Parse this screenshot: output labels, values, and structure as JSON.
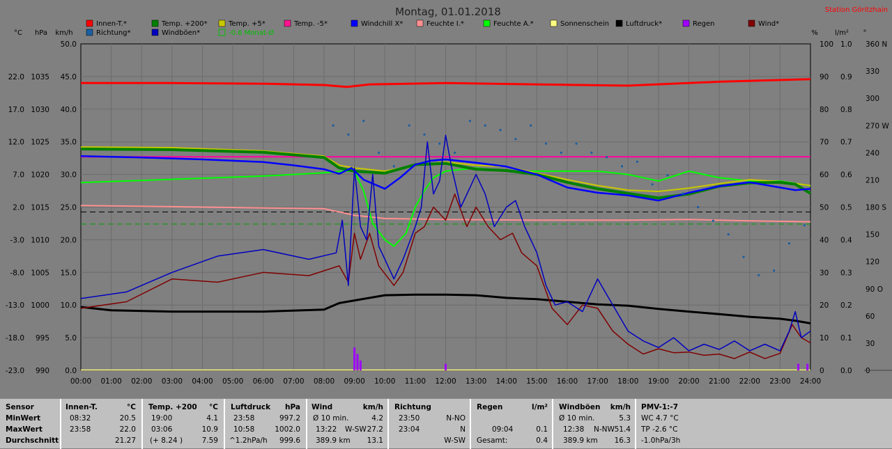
{
  "title": "Montag, 01.01.2018",
  "station": "Station Göritzhain",
  "colors": {
    "innen": "#ff0000",
    "temp200": "#008000",
    "temp5": "#c8c800",
    "tempm5": "#ff00a0",
    "windchill": "#0000ff",
    "feuchte_i": "#ff9090",
    "feuchte_a": "#00ff00",
    "sonne": "#ffff80",
    "luftdruck": "#000000",
    "regen": "#a000ff",
    "wind": "#800000",
    "richtung": "#1a5fa0",
    "windboeen": "#0000c0",
    "monat": "#00a000"
  },
  "legend": [
    {
      "label": "Innen-T.*",
      "color": "#ff0000",
      "style": "box"
    },
    {
      "label": "Temp. +200*",
      "color": "#008000",
      "style": "box"
    },
    {
      "label": "Temp. +5*",
      "color": "#c8c800",
      "style": "box"
    },
    {
      "label": "Temp. -5*",
      "color": "#ff1493",
      "style": "box"
    },
    {
      "label": "Windchill X*",
      "color": "#0000ff",
      "style": "box"
    },
    {
      "label": "Feuchte I.*",
      "color": "#ff9090",
      "style": "box"
    },
    {
      "label": "Feuchte A.*",
      "color": "#00ff00",
      "style": "box"
    },
    {
      "label": "Sonnenschein",
      "color": "#ffff80",
      "style": "box"
    },
    {
      "label": "Luftdruck*",
      "color": "#000000",
      "style": "box"
    },
    {
      "label": "Regen",
      "color": "#a000ff",
      "style": "box"
    },
    {
      "label": "Wind*",
      "color": "#800000",
      "style": "box"
    },
    {
      "label": "Richtung*",
      "color": "#1a5fa0",
      "style": "box"
    },
    {
      "label": "Windböen*",
      "color": "#0000c0",
      "style": "box"
    },
    {
      "label": "-0.6 Monat-Ø",
      "color": "#00c000",
      "style": "outline"
    }
  ],
  "axis_headers": {
    "celsius": "°C",
    "hpa": "hPa",
    "kmh": "km/h",
    "percent": "%",
    "lm2": "l/m²",
    "deg": "°"
  },
  "chart_data": {
    "type": "line",
    "x_ticks": [
      "00:00",
      "01:00",
      "02:00",
      "03:00",
      "04:00",
      "05:00",
      "06:00",
      "07:00",
      "08:00",
      "09:00",
      "10:00",
      "11:00",
      "12:00",
      "13:00",
      "14:00",
      "15:00",
      "16:00",
      "17:00",
      "18:00",
      "19:00",
      "20:00",
      "21:00",
      "22:00",
      "23:00",
      "24:00"
    ],
    "y_axes": {
      "celsius": {
        "ticks": [
          "22.0",
          "17.0",
          "12.0",
          "7.0",
          "2.0",
          "-3.0",
          "-8.0",
          "-13.0",
          "-18.0",
          "-23.0"
        ],
        "range": [
          -23,
          27
        ]
      },
      "hpa": {
        "ticks": [
          "1035",
          "1030",
          "1025",
          "1020",
          "1015",
          "1010",
          "1005",
          "1000",
          "995",
          "990"
        ],
        "range": [
          990,
          1040
        ]
      },
      "kmh": {
        "ticks": [
          "50.0",
          "45.0",
          "40.0",
          "35.0",
          "30.0",
          "25.0",
          "20.0",
          "15.0",
          "10.0",
          "5.0",
          "0.0"
        ],
        "range": [
          0,
          50
        ]
      },
      "percent": {
        "ticks": [
          "100",
          "90",
          "80",
          "70",
          "60",
          "50",
          "40",
          "30",
          "20",
          "10",
          "0"
        ],
        "range": [
          0,
          100
        ]
      },
      "lm2": {
        "ticks": [
          "1.0",
          "0.9",
          "0.8",
          "0.7",
          "0.6",
          "0.5",
          "0.4",
          "0.3",
          "0.2",
          "0.1",
          "0.0"
        ],
        "range": [
          0,
          1
        ]
      },
      "deg": {
        "ticks": [
          "360 N",
          "330",
          "300",
          "270 W",
          "240",
          "210",
          "180 S",
          "150",
          "120",
          "90 O",
          "60",
          "30",
          "0"
        ],
        "range": [
          0,
          360
        ]
      }
    },
    "series": [
      {
        "name": "Innen-T.*",
        "axis": "celsius",
        "x": [
          0,
          3,
          6,
          8,
          8.75,
          9.5,
          12,
          15,
          18,
          21,
          24
        ],
        "y": [
          21.0,
          21.0,
          20.9,
          20.7,
          20.4,
          20.8,
          21.0,
          20.8,
          20.6,
          21.2,
          21.6
        ]
      },
      {
        "name": "Temp. +200*",
        "axis": "celsius",
        "x": [
          0,
          3,
          6,
          8,
          8.5,
          9,
          10,
          11,
          12,
          13,
          14,
          15,
          16,
          17,
          18,
          19,
          20,
          21,
          22,
          23,
          23.5,
          24
        ],
        "y": [
          10.9,
          10.8,
          10.4,
          9.6,
          8.0,
          7.5,
          7.2,
          8.5,
          8.7,
          7.8,
          7.6,
          7.0,
          5.8,
          4.8,
          4.1,
          3.4,
          4.0,
          5.2,
          5.7,
          5.8,
          5.5,
          4.1
        ]
      },
      {
        "name": "Temp. +5*",
        "axis": "celsius",
        "x": [
          0,
          3,
          6,
          8,
          8.5,
          9,
          10,
          11,
          12,
          13,
          14,
          15,
          16,
          17,
          18,
          19,
          20,
          21,
          22,
          23,
          24
        ],
        "y": [
          11.2,
          11.1,
          10.6,
          9.8,
          8.4,
          8.0,
          7.5,
          8.4,
          8.9,
          8.4,
          8.2,
          7.2,
          6.2,
          5.3,
          4.6,
          4.4,
          4.9,
          5.6,
          6.2,
          5.9,
          5.3
        ]
      },
      {
        "name": "Temp. -5*",
        "axis": "celsius",
        "x": [
          0,
          24
        ],
        "y": [
          9.7,
          9.7
        ]
      },
      {
        "name": "Windchill X*",
        "axis": "celsius",
        "x": [
          0,
          2,
          4,
          6,
          7,
          8,
          8.5,
          8.9,
          9.3,
          10,
          10.5,
          11,
          11.5,
          12,
          13,
          14,
          15,
          16,
          17,
          18,
          19,
          20,
          21,
          22,
          23,
          23.5,
          24
        ],
        "y": [
          9.8,
          9.6,
          9.3,
          8.9,
          8.4,
          7.8,
          7.1,
          8.0,
          6.2,
          4.8,
          6.5,
          8.5,
          9.1,
          9.3,
          8.8,
          8.2,
          7.0,
          5.0,
          4.2,
          3.8,
          3.0,
          4.2,
          5.2,
          5.8,
          5.0,
          4.6,
          4.8
        ]
      },
      {
        "name": "Feuchte I.*",
        "axis": "percent",
        "x": [
          0,
          4,
          8,
          9,
          10,
          12,
          15,
          18,
          20,
          22,
          24
        ],
        "y": [
          50.5,
          50.0,
          49.5,
          47.5,
          46.5,
          46.2,
          46.0,
          46.0,
          46.2,
          45.8,
          45.5
        ]
      },
      {
        "name": "Feuchte A.*",
        "axis": "percent",
        "x": [
          0,
          3,
          6,
          8,
          8.6,
          9,
          9.3,
          9.6,
          10,
          10.3,
          10.7,
          11,
          11.3,
          11.6,
          12,
          13,
          14,
          15,
          16,
          17,
          18,
          18.5,
          19,
          20,
          21,
          22,
          23,
          24
        ],
        "y": [
          57.5,
          58.5,
          59.5,
          60.5,
          61,
          61,
          55,
          45,
          40,
          38,
          42,
          50,
          55,
          59,
          61,
          62,
          61,
          61,
          61,
          61,
          60,
          59,
          58,
          61,
          59,
          58,
          58,
          56.5
        ]
      },
      {
        "name": "Luftdruck*",
        "axis": "hpa",
        "x": [
          0,
          1,
          3,
          6,
          8,
          8.5,
          9,
          10,
          11,
          12,
          13,
          14,
          15,
          16,
          17,
          18,
          19,
          20,
          21,
          22,
          23,
          23.5,
          24
        ],
        "y": [
          999.7,
          999.2,
          999.0,
          999.0,
          999.3,
          1000.3,
          1000.7,
          1001.5,
          1001.6,
          1001.6,
          1001.5,
          1001.1,
          1000.9,
          1000.5,
          1000.1,
          999.9,
          999.4,
          999.0,
          998.6,
          998.2,
          997.9,
          997.6,
          997.2
        ]
      },
      {
        "name": "Wind*",
        "axis": "kmh",
        "x": [
          0,
          1.5,
          3,
          4.5,
          6,
          7.5,
          8.5,
          8.8,
          9,
          9.2,
          9.5,
          9.8,
          10.3,
          10.6,
          11,
          11.3,
          11.6,
          12,
          12.3,
          12.7,
          13,
          13.4,
          13.8,
          14.2,
          14.5,
          15,
          15.5,
          16,
          16.5,
          17,
          17.5,
          18,
          18.5,
          19,
          19.5,
          20,
          20.5,
          21,
          21.5,
          22,
          22.5,
          23,
          23.4,
          23.7,
          24
        ],
        "y": [
          9.5,
          10.5,
          14,
          13.5,
          15,
          14.5,
          16,
          13.5,
          21,
          17,
          21,
          16,
          13,
          15,
          21,
          22,
          25,
          23,
          27,
          22,
          25,
          22,
          20,
          21,
          18,
          16,
          9.5,
          7,
          10,
          9.5,
          6,
          4,
          2.5,
          3.3,
          2.7,
          2.8,
          2.3,
          2.5,
          1.8,
          2.8,
          1.8,
          2.6,
          7,
          5,
          4.2
        ]
      },
      {
        "name": "Windböen*",
        "axis": "kmh",
        "x": [
          0,
          1.5,
          3,
          4.5,
          6,
          7.5,
          8.4,
          8.6,
          8.8,
          9,
          9.2,
          9.4,
          9.6,
          9.8,
          10,
          10.3,
          10.6,
          11,
          11.2,
          11.4,
          11.6,
          11.8,
          12,
          12.2,
          12.5,
          12.8,
          13,
          13.3,
          13.6,
          14,
          14.3,
          14.6,
          15,
          15.3,
          15.6,
          16,
          16.5,
          17,
          17.5,
          18,
          18.5,
          19,
          19.5,
          20,
          20.5,
          21,
          21.5,
          22,
          22.5,
          23,
          23.3,
          23.5,
          23.7,
          24
        ],
        "y": [
          11,
          12,
          15,
          17.5,
          18.5,
          17,
          18,
          23,
          13,
          31,
          22,
          20,
          30,
          19,
          17,
          14,
          17,
          22,
          25,
          35,
          27,
          29,
          36,
          31,
          25,
          28,
          30,
          27,
          22,
          25,
          26,
          22,
          18,
          13,
          10,
          10.5,
          9,
          14,
          10,
          6,
          4.5,
          3.5,
          5,
          3,
          4,
          3.2,
          4.5,
          3,
          4,
          3,
          6,
          9,
          5,
          6
        ]
      },
      {
        "name": "Richtung*",
        "axis": "deg",
        "x": [
          8.3,
          8.8,
          9.3,
          9.8,
          10.3,
          10.8,
          11.3,
          11.8,
          12.3,
          12.8,
          13.3,
          13.8,
          14.3,
          14.8,
          15.3,
          15.8,
          16.3,
          16.8,
          17.3,
          17.8,
          18.3,
          18.8,
          19.3,
          19.8,
          20.3,
          20.8,
          21.3,
          21.8,
          22.3,
          22.8,
          23.3,
          23.8
        ],
        "y": [
          270,
          260,
          275,
          240,
          225,
          270,
          260,
          250,
          240,
          275,
          270,
          265,
          255,
          270,
          250,
          240,
          250,
          240,
          235,
          225,
          230,
          205,
          215,
          195,
          180,
          165,
          150,
          125,
          105,
          110,
          140,
          160
        ]
      },
      {
        "name": "Regen",
        "axis": "lm2",
        "x": [
          9.0,
          9.1,
          9.2,
          12.0,
          23.6,
          23.9
        ],
        "y": [
          0.07,
          0.05,
          0.03,
          0.02,
          0.02,
          0.02
        ]
      }
    ],
    "refs": [
      {
        "name": "-0.6 Monat-Ø",
        "axis": "celsius",
        "y": -0.6,
        "style": "dashed",
        "color": "#00a000"
      },
      {
        "name": "Feuchte-Ref",
        "axis": "percent",
        "y": 48.5,
        "style": "dashed",
        "color": "#000000"
      }
    ]
  },
  "footer": {
    "sensor": {
      "header": "Sensor",
      "rows": [
        "MinWert",
        "MaxWert",
        "Durchschnitt"
      ]
    },
    "innen": {
      "header": "Innen-T.",
      "unit": "°C",
      "rows": [
        [
          "08:32",
          "20.5"
        ],
        [
          "23:58",
          "22.0"
        ],
        [
          "",
          "21.27"
        ]
      ]
    },
    "temp200": {
      "header": "Temp. +200",
      "unit": "°C",
      "rows": [
        [
          "19:00",
          "4.1"
        ],
        [
          "03:06",
          "10.9"
        ],
        [
          "(+ 8.24 )",
          "7.59"
        ]
      ]
    },
    "luftdruck": {
      "header": "Luftdruck",
      "unit": "hPa",
      "rows": [
        [
          "23:58",
          "997.2"
        ],
        [
          "10:58",
          "1002.0"
        ],
        [
          "^1.2hPa/h",
          "999.6"
        ]
      ]
    },
    "wind": {
      "header": "Wind",
      "unit": "km/h",
      "rows": [
        [
          "Ø 10 min.",
          "",
          "4.2"
        ],
        [
          "13:22",
          "W-SW",
          "27.2"
        ],
        [
          "389.9 km",
          "",
          "13.1"
        ]
      ]
    },
    "richtung": {
      "header": "Richtung",
      "rows": [
        [
          "23:50",
          "N-NO"
        ],
        [
          "23:04",
          "N"
        ],
        [
          "",
          "W-SW"
        ]
      ]
    },
    "regen": {
      "header": "Regen",
      "unit": "l/m²",
      "rows": [
        [
          "",
          ""
        ],
        [
          "09:04",
          "0.1"
        ],
        [
          "Gesamt:",
          "0.4"
        ]
      ]
    },
    "windboeen": {
      "header": "Windböen",
      "unit": "km/h",
      "rows": [
        [
          "Ø 10 min.",
          "",
          "5.3"
        ],
        [
          "12:38",
          "N-NW",
          "51.4"
        ],
        [
          "389.9 km",
          "",
          "16.3"
        ]
      ]
    },
    "pmv": {
      "header": "PMV-1:-7",
      "rows": [
        "WC 4.7 °C",
        "TP -2.6 °C",
        "-1.0hPa/3h"
      ]
    }
  }
}
